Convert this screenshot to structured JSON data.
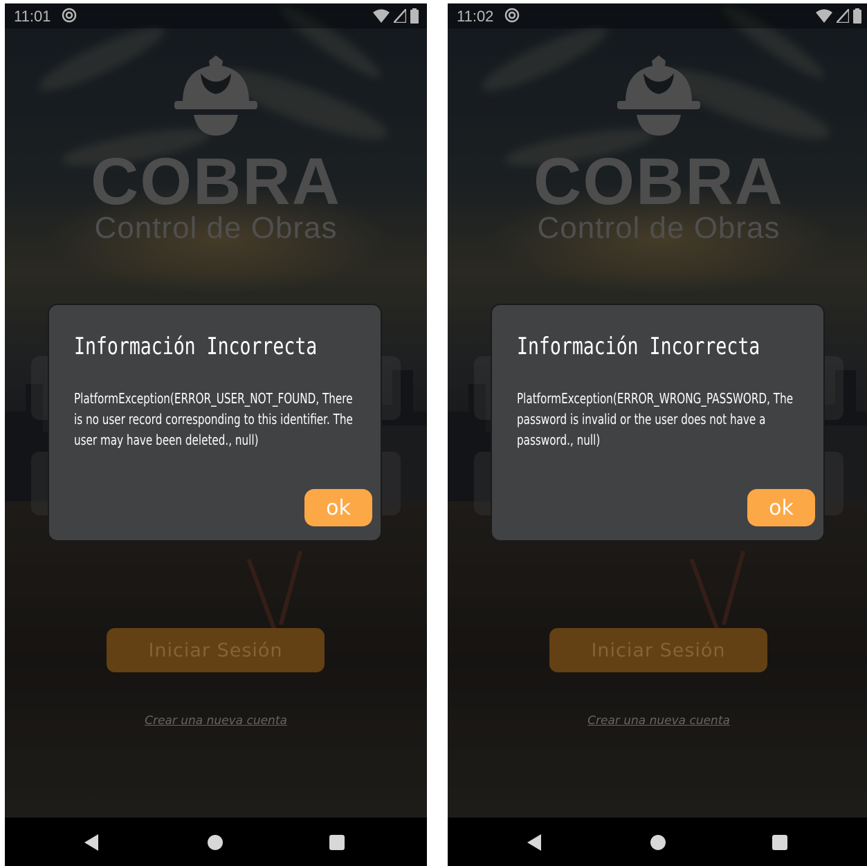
{
  "screens": [
    {
      "status": {
        "time": "11:01"
      },
      "logo": {
        "title": "COBRA",
        "subtitle": "Control de Obras"
      },
      "dialog": {
        "title": "Información Incorrecta",
        "message": "PlatformException(ERROR_USER_NOT_FOUND, There is no user record corresponding to this identifier. The user may have been deleted., null)",
        "ok_label": "ok"
      },
      "login_button": "Iniciar Sesión",
      "create_account_link": "Crear una nueva cuenta"
    },
    {
      "status": {
        "time": "11:02"
      },
      "logo": {
        "title": "COBRA",
        "subtitle": "Control de Obras"
      },
      "dialog": {
        "title": "Información Incorrecta",
        "message": "PlatformException(ERROR_WRONG_PASSWORD, The password is invalid or the user does not have a password., null)",
        "ok_label": "ok"
      },
      "login_button": "Iniciar Sesión",
      "create_account_link": "Crear una nueva cuenta"
    }
  ],
  "colors": {
    "accent": "#fda846",
    "dialog_bg": "#414244",
    "login_button_bg": "#8a5b1c"
  },
  "icons": [
    "app-notification-icon",
    "wifi-icon",
    "cell-signal-icon",
    "battery-icon",
    "helmet-logo-icon",
    "back-icon",
    "home-icon",
    "recents-icon"
  ]
}
